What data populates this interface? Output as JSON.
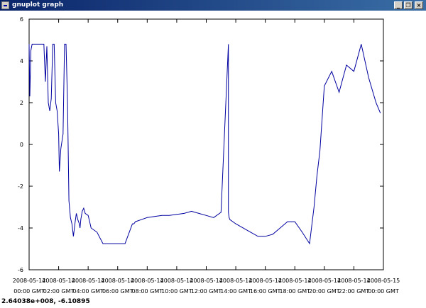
{
  "window": {
    "title": "gnuplot graph",
    "buttons": {
      "minimize": "_",
      "restore": "❐",
      "close": "×"
    }
  },
  "status": {
    "coords": "2.64038e+008, -6.10895"
  },
  "chart_data": {
    "type": "line",
    "title": "",
    "xlabel": "",
    "ylabel": "",
    "ylim": [
      -6,
      6
    ],
    "yticks": [
      -6,
      -4,
      -2,
      0,
      2,
      4,
      6
    ],
    "xticks": [
      {
        "date": "2008-05-14",
        "time": "00:00 GMT"
      },
      {
        "date": "2008-05-14",
        "time": "02:00 GMT"
      },
      {
        "date": "2008-05-14",
        "time": "04:00 GMT"
      },
      {
        "date": "2008-05-14",
        "time": "06:00 GMT"
      },
      {
        "date": "2008-05-14",
        "time": "08:00 GMT"
      },
      {
        "date": "2008-05-14",
        "time": "10:00 GMT"
      },
      {
        "date": "2008-05-14",
        "time": "12:00 GMT"
      },
      {
        "date": "2008-05-14",
        "time": "14:00 GMT"
      },
      {
        "date": "2008-05-14",
        "time": "16:00 GMT"
      },
      {
        "date": "2008-05-14",
        "time": "18:00 GMT"
      },
      {
        "date": "2008-05-14",
        "time": "20:00 GMT"
      },
      {
        "date": "2008-05-14",
        "time": "22:00 GMT"
      },
      {
        "date": "2008-05-15",
        "time": "00:00 GMT"
      }
    ],
    "grid": false,
    "line_color": "#0000a0",
    "series": [
      {
        "x": [
          0.0,
          0.05,
          0.12,
          0.2,
          0.3,
          0.45,
          0.6,
          0.8,
          1.0,
          1.1,
          1.2,
          1.3,
          1.4,
          1.5,
          1.6,
          1.7,
          1.8,
          1.9,
          2.0,
          2.05,
          2.15,
          2.3,
          2.4,
          2.5,
          2.6,
          2.7,
          2.8,
          2.9,
          3.0,
          3.1,
          3.2,
          3.3,
          3.4,
          3.45,
          3.5,
          3.6,
          3.7,
          3.8,
          4.0,
          4.2,
          4.6,
          5.0,
          5.5,
          6.0,
          6.5,
          7.0,
          7.1,
          7.2,
          7.6,
          8.0,
          8.5,
          9.0,
          9.5,
          10.0,
          10.5,
          11.0,
          11.5,
          12.0,
          12.5,
          13.0,
          13.5,
          13.5,
          13.55,
          13.6,
          14.0,
          15.0,
          15.5,
          16.0,
          16.5,
          17.0,
          17.5,
          18.0,
          18.5,
          19.0,
          19.3,
          19.5,
          19.7,
          20.0,
          20.5,
          21.0,
          21.5,
          22.0,
          22.5,
          23.0,
          23.5,
          23.8
        ],
        "y": [
          4.8,
          2.3,
          4.5,
          4.8,
          4.8,
          4.8,
          4.8,
          4.8,
          4.8,
          3.0,
          4.7,
          2.0,
          1.6,
          2.2,
          4.8,
          4.8,
          2.0,
          1.6,
          0.5,
          -1.3,
          -0.2,
          0.5,
          4.8,
          4.8,
          2.0,
          -2.7,
          -3.5,
          -3.8,
          -4.4,
          -3.8,
          -3.3,
          -3.6,
          -3.8,
          -4.0,
          -3.6,
          -3.2,
          -3.05,
          -3.3,
          -3.4,
          -4.0,
          -4.2,
          -4.75,
          -4.75,
          -4.75,
          -4.75,
          -3.8,
          -3.8,
          -3.7,
          -3.6,
          -3.5,
          -3.45,
          -3.4,
          -3.4,
          -3.35,
          -3.3,
          -3.2,
          -3.3,
          -3.4,
          -3.5,
          -3.25,
          4.8,
          -3.25,
          -3.5,
          -3.6,
          -3.8,
          -4.2,
          -4.4,
          -4.4,
          -4.3,
          -4.0,
          -3.7,
          -3.7,
          -4.2,
          -4.75,
          -3.0,
          -1.5,
          -0.3,
          2.8,
          3.5,
          2.5,
          3.8,
          3.5,
          4.8,
          3.2,
          2.0,
          1.5
        ]
      }
    ]
  }
}
